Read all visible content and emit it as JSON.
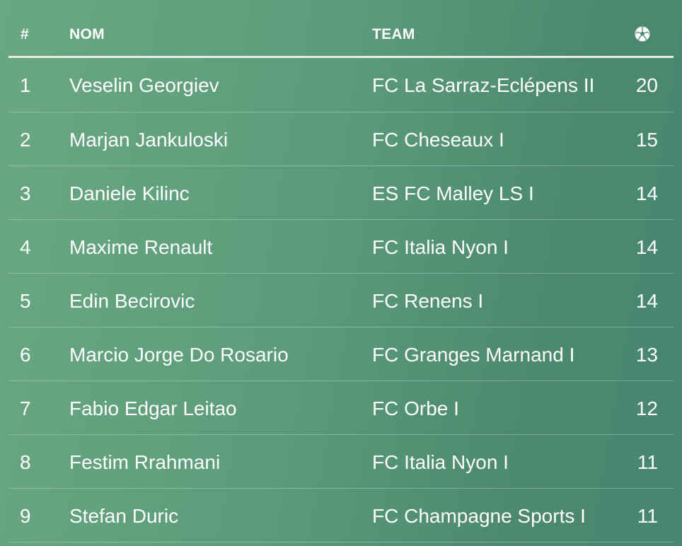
{
  "table": {
    "headers": {
      "rank": "#",
      "name": "NOM",
      "team": "TEAM",
      "goals_icon": "soccer-ball-icon"
    },
    "rows": [
      {
        "rank": "1",
        "name": "Veselin Georgiev",
        "team": "FC La Sarraz-Eclépens II",
        "goals": "20"
      },
      {
        "rank": "2",
        "name": "Marjan Jankuloski",
        "team": "FC Cheseaux I",
        "goals": "15"
      },
      {
        "rank": "3",
        "name": "Daniele Kilinc",
        "team": "ES FC Malley LS I",
        "goals": "14"
      },
      {
        "rank": "4",
        "name": "Maxime Renault",
        "team": "FC Italia Nyon I",
        "goals": "14"
      },
      {
        "rank": "5",
        "name": "Edin Becirovic",
        "team": "FC Renens I",
        "goals": "14"
      },
      {
        "rank": "6",
        "name": "Marcio Jorge Do Rosario",
        "team": "FC Granges Marnand I",
        "goals": "13"
      },
      {
        "rank": "7",
        "name": "Fabio Edgar Leitao",
        "team": "FC Orbe I",
        "goals": "12"
      },
      {
        "rank": "8",
        "name": "Festim Rrahmani",
        "team": "FC Italia Nyon I",
        "goals": "11"
      },
      {
        "rank": "9",
        "name": "Stefan Duric",
        "team": "FC Champagne Sports I",
        "goals": "11"
      }
    ]
  },
  "colors": {
    "background_start": "#69a880",
    "background_end": "#468570",
    "text": "#ffffff",
    "header_rule": "#e6ece8"
  }
}
